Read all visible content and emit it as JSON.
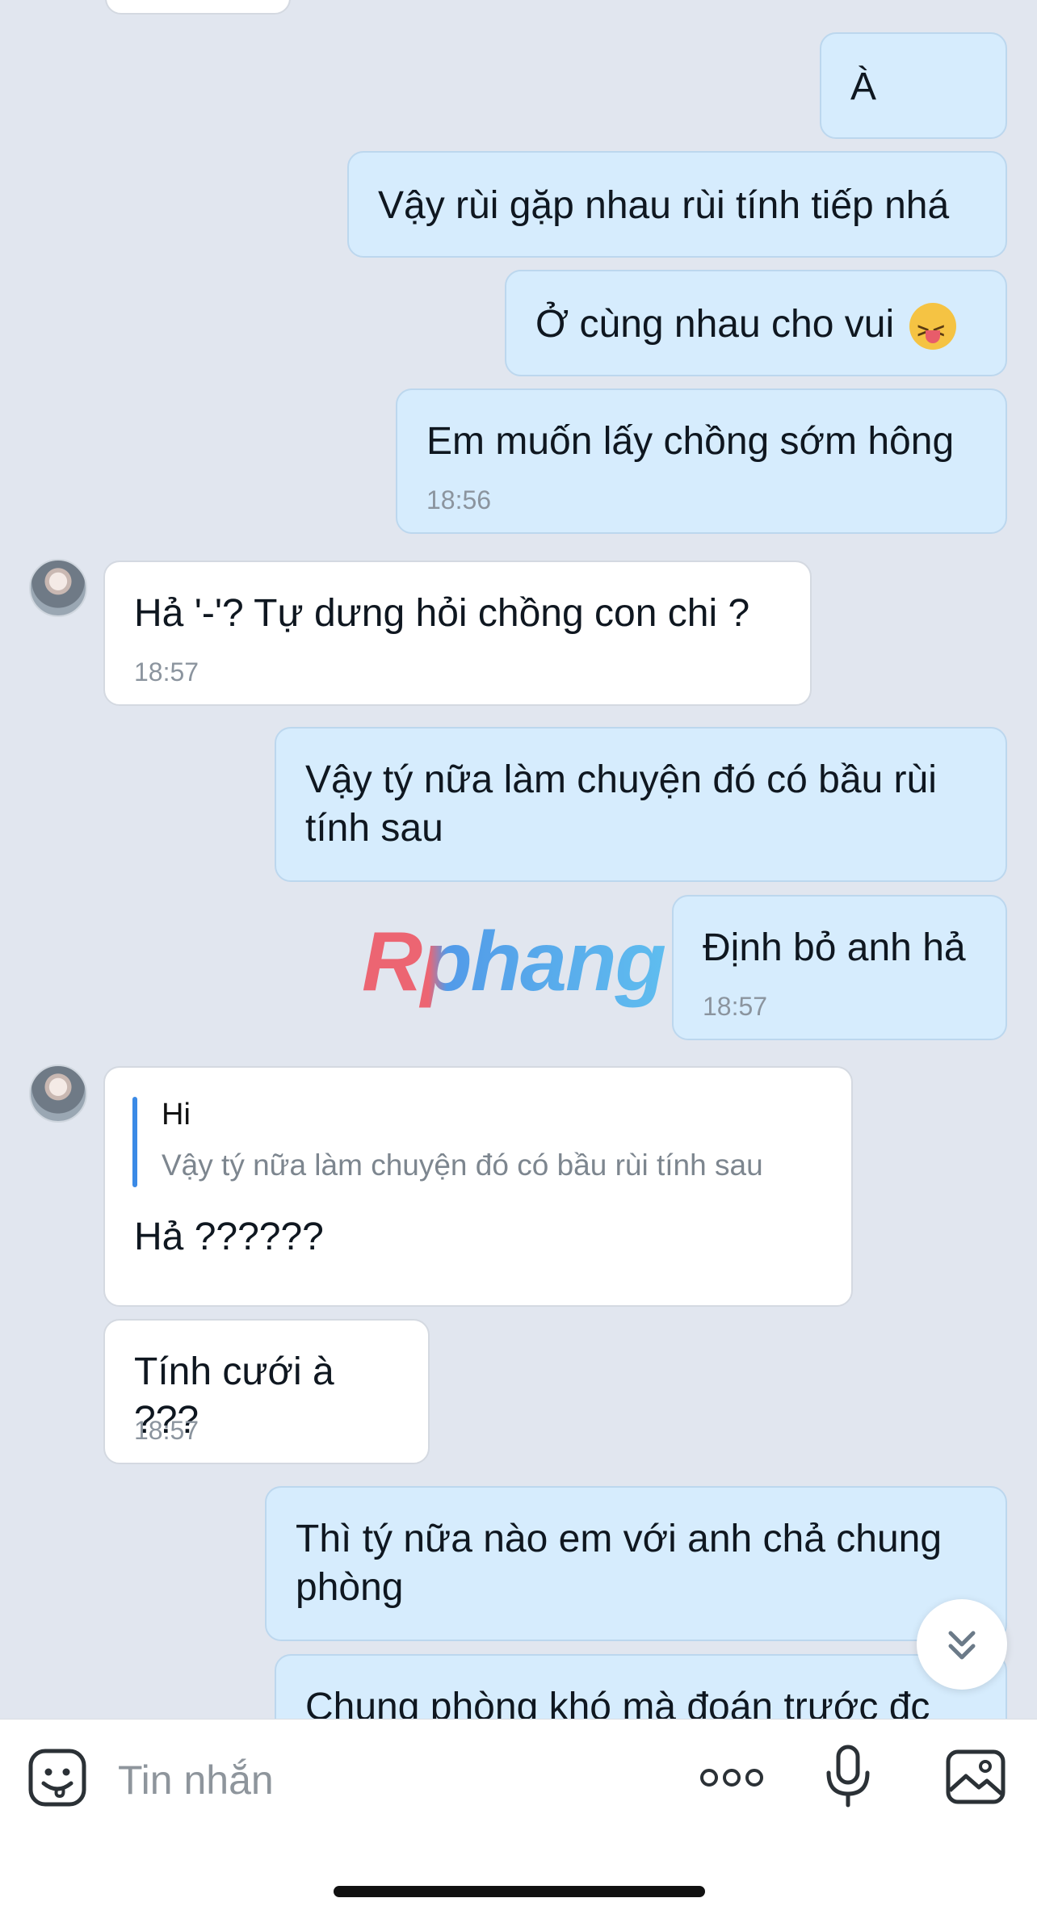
{
  "messages": {
    "m1": "À",
    "m2": "Vậy rùi gặp nhau rùi tính tiếp nhá",
    "m3": "Ở cùng nhau cho vui",
    "m4": "Em muốn lấy chồng sớm hông",
    "m4_time": "18:56",
    "m5": "Hả '-'? Tự dưng hỏi chồng con chi ?",
    "m5_time": "18:57",
    "m6_line1": "Vậy tý nữa làm chuyện đó có bầu rùi",
    "m6_line2": "tính sau",
    "m7": "Định bỏ anh hả",
    "m7_time": "18:57",
    "m8_quote_title": "Hi",
    "m8_quote_text": "Vậy tý nữa làm chuyện đó có bầu rùi tính sau",
    "m8": "Hả ??????",
    "m9": "Tính cưới à ???",
    "m9_time": "18:57",
    "m10_line1": "Thì tý nữa nào em với anh chả chung",
    "m10_line2": "phòng",
    "m11": "Chung phòng khó mà đoán trước đc"
  },
  "watermark": "Rphang",
  "composer": {
    "placeholder": "Tin nhắn"
  },
  "icons": {
    "emoji_reaction": "squinting-tongue-emoji",
    "sticker": "sticker-smile-icon",
    "more": "more-dots-icon",
    "mic": "microphone-icon",
    "image": "image-icon",
    "scroll": "double-chevron-down-icon"
  },
  "colors": {
    "background": "#e1e6ef",
    "outgoing_bubble": "#d6ecfd",
    "incoming_bubble": "#ffffff",
    "quote_bar": "#3b8ae6"
  }
}
